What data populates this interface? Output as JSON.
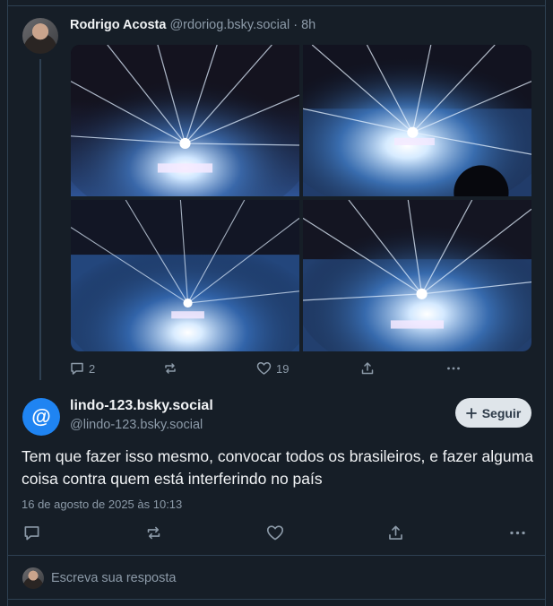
{
  "parent_post": {
    "author_name": "Rodrigo Acosta",
    "author_handle": "@rdoriog.bsky.social",
    "time": " · 8h",
    "image_count": 4,
    "actions": {
      "replies": "2",
      "likes": "19"
    }
  },
  "reply_post": {
    "avatar_glyph": "@",
    "display_name": "lindo-123.bsky.social",
    "handle": "@lindo-123.bsky.social",
    "follow_label": "Seguir",
    "text": "Tem que fazer isso mesmo, convocar todos os brasileiros, e fazer alguma coisa contra quem está interferindo no país",
    "date": "16 de agosto de 2025 às 10:13"
  },
  "compose": {
    "placeholder": "Escreva sua resposta"
  },
  "colors": {
    "background": "#161e27",
    "accent": "#1f84f2",
    "muted": "#8c9aa8",
    "border": "#2e4052"
  },
  "icons": [
    "reply-icon",
    "repost-icon",
    "like-icon",
    "share-icon",
    "more-icon",
    "plus-icon"
  ]
}
